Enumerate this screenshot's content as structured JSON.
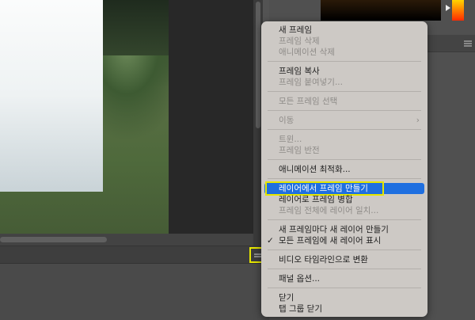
{
  "menu": {
    "new_frame": "새 프레임",
    "delete_frame": "프레임 삭제",
    "delete_animation": "애니메이션 삭제",
    "copy_frame": "프레임 복사",
    "paste_frame": "프레임 붙여넣기...",
    "select_all_frames": "모든 프레임 선택",
    "move": "이동",
    "tween": "트윈...",
    "reverse_frames": "프레임 반전",
    "optimize_animation": "애니메이션 최적화...",
    "make_frames_from_layers": "레이어에서 프레임 만들기",
    "flatten_frames_into_layers": "레이어로 프레임 병합",
    "match_layer_across_frames": "프레임 전체에 레이어 일치...",
    "create_new_layer_each_frame": "새 프레임마다 새 레이어 만들기",
    "new_layers_visible_all_frames": "모든 프레임에 새 레이어 표시",
    "convert_to_video_timeline": "비디오 타임라인으로 변환",
    "panel_options": "패널 옵션...",
    "close": "닫기",
    "close_tab_group": "탭 그룹 닫기",
    "submenu_arrow": "›",
    "checkmark": "✓"
  },
  "colors": {
    "highlight": "#1f6fe0",
    "annotation": "#e6e600"
  }
}
